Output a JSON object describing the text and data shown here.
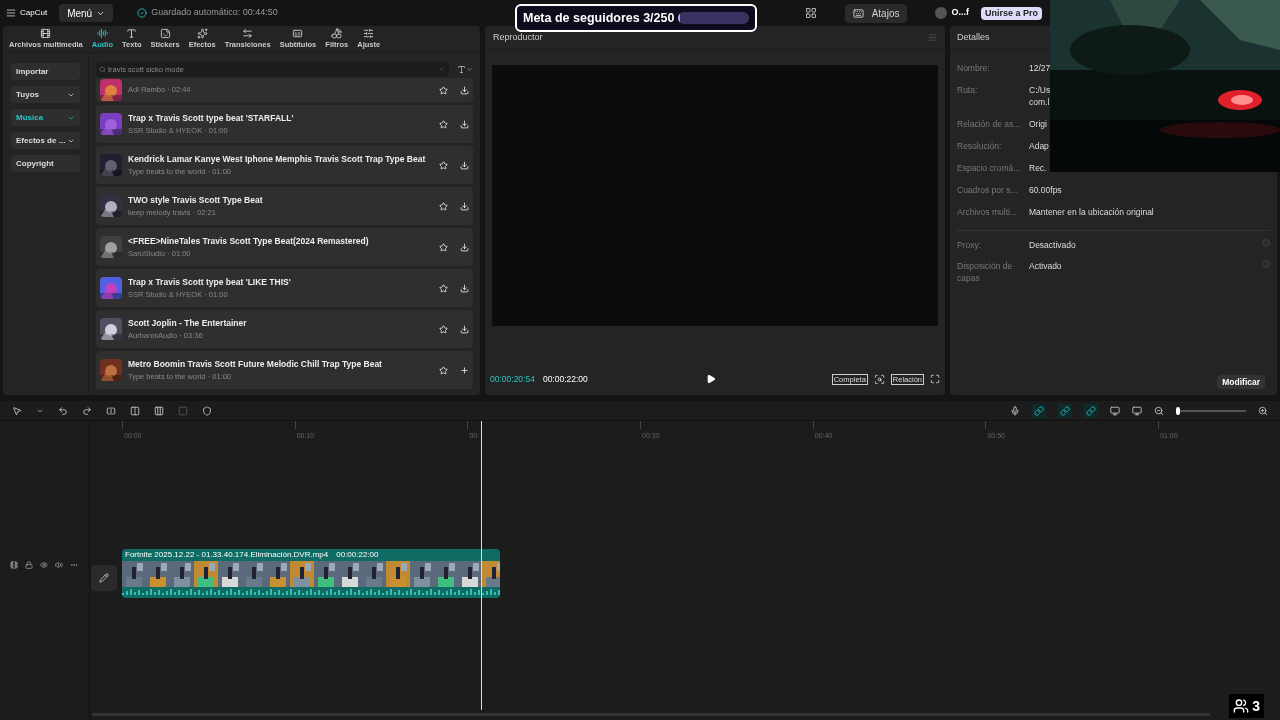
{
  "top_bar": {
    "logo": "CapCut",
    "menu": "Menú",
    "autosave": "Guardado automático: 00:44:50",
    "shortcuts": "Atajos",
    "user": "O...f",
    "pro": "Unirse a Pro"
  },
  "follower_goal": {
    "text": "Meta de seguidores 3/250",
    "level": 0.02
  },
  "tabs": [
    {
      "label": "Archivos multimedia",
      "selected": false
    },
    {
      "label": "Audio",
      "selected": true
    },
    {
      "label": "Texto",
      "selected": false
    },
    {
      "label": "Stickers",
      "selected": false
    },
    {
      "label": "Efectos",
      "selected": false
    },
    {
      "label": "Transiciones",
      "selected": false
    },
    {
      "label": "Subtítulos",
      "selected": false
    },
    {
      "label": "Filtros",
      "selected": false
    },
    {
      "label": "Ajuste",
      "selected": false
    }
  ],
  "sidebar": [
    {
      "label": "Importar",
      "selected": false,
      "dropdown": false
    },
    {
      "label": "Tuyos",
      "selected": false,
      "dropdown": true
    },
    {
      "label": "Música",
      "selected": true,
      "dropdown": true
    },
    {
      "label": "Efectos de ...",
      "selected": false,
      "dropdown": true
    },
    {
      "label": "Copyright",
      "selected": false,
      "dropdown": false
    }
  ],
  "search": {
    "value": "travis scott sicko mode"
  },
  "songs": [
    {
      "meta": "Adi Rambo · 02:44",
      "kind": "download"
    },
    {
      "title": "Trap x Travis Scott type beat 'STARFALL'",
      "meta": "SSR Studio & HYEOK · 01:00",
      "kind": "download"
    },
    {
      "title": "Kendrick Lamar Kanye West Iphone Memphis Travis Scott Trap Type Beat",
      "meta": "Type beats to the world · 01:00",
      "kind": "download"
    },
    {
      "title": "TWO style Travis Scott Type Beat",
      "meta": "keep melody travis · 02:21",
      "kind": "download"
    },
    {
      "title": "<FREE>NineTales Travis Scott Type Beat(2024 Remastered)",
      "meta": "SaruStudio · 01:00",
      "kind": "download"
    },
    {
      "title": "Trap x Travis Scott type beat 'LIKE THIS'",
      "meta": "SSR Studio & HYEOK · 01:00",
      "kind": "download"
    },
    {
      "title": "Scott Joplin - The Entertainer",
      "meta": "AurbanniAudio · 03:36",
      "kind": "download"
    },
    {
      "title": "Metro Boomin Travis Scott Future Melodic Chill Trap Type Beat",
      "meta": "Type beats to the world · 01:00",
      "kind": "add"
    }
  ],
  "player": {
    "title": "Reproductor",
    "current": "00:00:20:54",
    "total": "00:00:22:00",
    "buttons": [
      "Completa",
      "Relación"
    ]
  },
  "details": {
    "title": "Detalles",
    "rows": [
      {
        "label": "Nombre:",
        "value": "12/27"
      },
      {
        "label": "Ruta:",
        "value": [
          "C:/Us",
          "com.l"
        ]
      },
      {
        "label": "Relación de as...",
        "value": "Origi"
      },
      {
        "label": "Resolución:",
        "value": "Adap"
      },
      {
        "label": "Espacio cromá...",
        "value": "Rec."
      },
      {
        "label": "Cuadros por s...",
        "value": "60.00fps"
      },
      {
        "label": "Archivos multi...",
        "value": "Mantener en la ubicación original"
      }
    ],
    "settings": [
      {
        "label": "Proxy:",
        "value": "Desactivado"
      },
      {
        "label": "Disposición de capas",
        "value": "Activado"
      }
    ],
    "button": "Modificar"
  },
  "timeline": {
    "zoom": {
      "level": 0.03
    },
    "ruler": [
      "00:00",
      "00:10",
      "00:",
      "00:30",
      "00:40",
      "00:50",
      "01:00"
    ],
    "clip": {
      "name": "Fortnite 2025.12.22 - 01.33.40.174.Eliminación.DVR.mp4",
      "duration": "00:00:22:00"
    }
  },
  "viewers": "3"
}
